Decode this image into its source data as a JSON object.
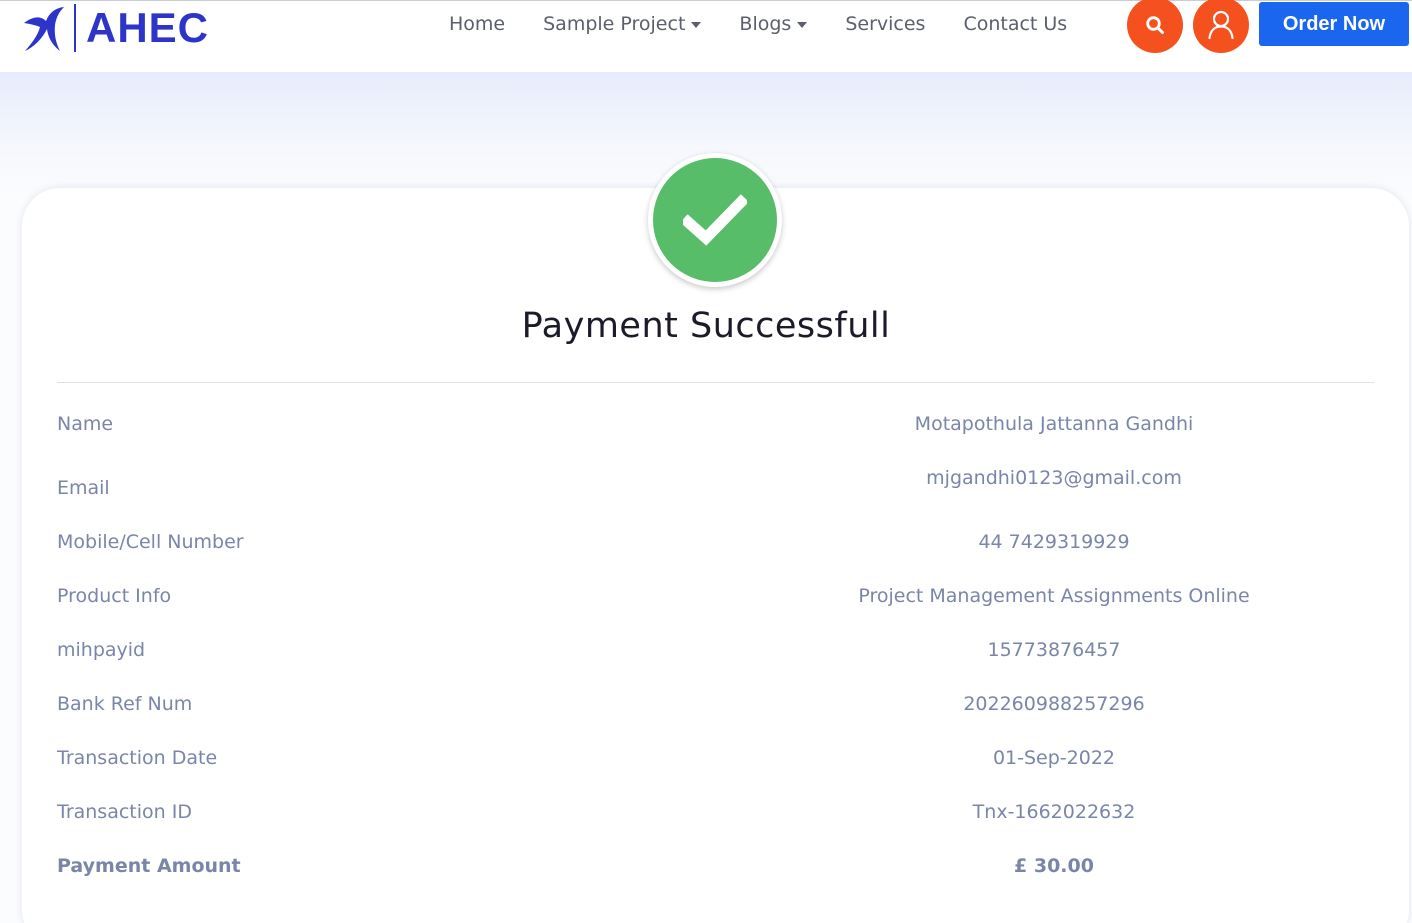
{
  "header": {
    "logo_text": "AHEC",
    "nav": {
      "home": "Home",
      "sample_project": "Sample Project",
      "blogs": "Blogs",
      "services": "Services",
      "contact": "Contact Us"
    },
    "order_label": "Order Now",
    "icons": {
      "search": "search-icon",
      "user": "user-icon",
      "logo": "bird-logo-icon"
    }
  },
  "status": {
    "icon": "check-icon",
    "title": "Payment Successfull"
  },
  "details": {
    "rows": [
      {
        "label": "Name",
        "value": "Motapothula Jattanna Gandhi"
      },
      {
        "label": "Email",
        "value": "mjgandhi0123@gmail.com"
      },
      {
        "label": "Mobile/Cell Number",
        "value": "44 7429319929"
      },
      {
        "label": "Product Info",
        "value": "Project Management Assignments Online"
      },
      {
        "label": "mihpayid",
        "value": "15773876457"
      },
      {
        "label": "Bank Ref Num",
        "value": "202260988257296"
      },
      {
        "label": "Transaction Date",
        "value": "01-Sep-2022"
      },
      {
        "label": "Transaction ID",
        "value": "Tnx-1662022632"
      },
      {
        "label": "Payment Amount",
        "value": "£ 30.00"
      }
    ]
  },
  "colors": {
    "brand": "#2d35c9",
    "accent": "#f4511e",
    "primary_button": "#1a66ee",
    "success": "#57bd68",
    "detail_text": "#7a86a8"
  }
}
